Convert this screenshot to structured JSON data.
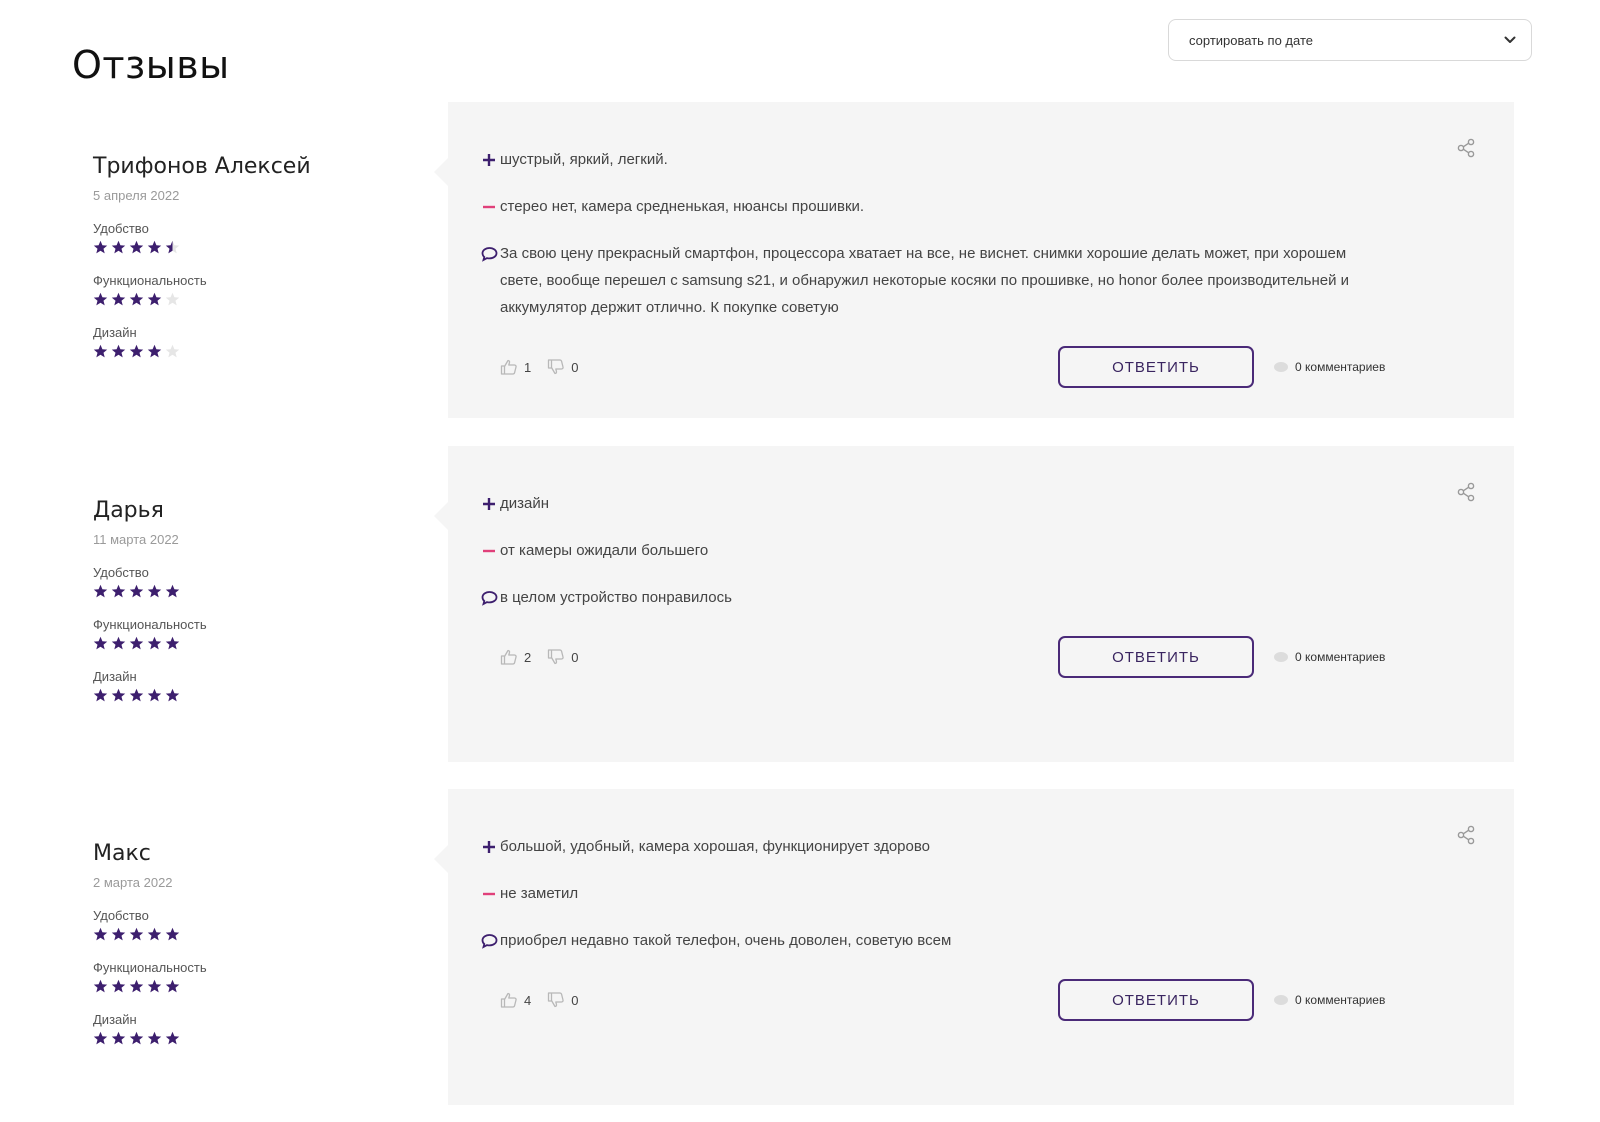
{
  "header": {
    "title": "Отзывы",
    "sort_label": "сортировать по дате"
  },
  "colors": {
    "accent": "#3d1f6e",
    "minus": "#e0407a",
    "card_bg": "#f5f5f5"
  },
  "actions": {
    "reply_label": "ОТВЕТИТЬ"
  },
  "reviews": [
    {
      "author": "Трифонов Алексей",
      "date": "5 апреля 2022",
      "ratings": [
        {
          "label": "Удобство",
          "value": 4.5
        },
        {
          "label": "Функциональность",
          "value": 4
        },
        {
          "label": "Дизайн",
          "value": 4
        }
      ],
      "pros": "шустрый, яркий, легкий.",
      "cons": "стерео нет, камера средненькая, нюансы прошивки.",
      "comment": "За свою цену прекрасный смартфон, процессора хватает на все, не виснет. снимки хорошие делать может, при хорошем свете, вообще перешел с samsung s21, и обнаружил некоторые косяки по прошивке, но honor более производительней и аккумулятор держит отлично. К покупке советую",
      "likes": "1",
      "dislikes": "0",
      "comments_count": "0 комментариев"
    },
    {
      "author": "Дарья",
      "date": "11 марта 2022",
      "ratings": [
        {
          "label": "Удобство",
          "value": 5
        },
        {
          "label": "Функциональность",
          "value": 5
        },
        {
          "label": "Дизайн",
          "value": 5
        }
      ],
      "pros": "дизайн",
      "cons": "от камеры ожидали большего",
      "comment": "в целом устройство понравилось",
      "likes": "2",
      "dislikes": "0",
      "comments_count": "0 комментариев"
    },
    {
      "author": "Макс",
      "date": "2 марта 2022",
      "ratings": [
        {
          "label": "Удобство",
          "value": 5
        },
        {
          "label": "Функциональность",
          "value": 5
        },
        {
          "label": "Дизайн",
          "value": 5
        }
      ],
      "pros": "большой, удобный, камера хорошая, функционирует здорово",
      "cons": "не заметил",
      "comment": "приобрел недавно такой телефон, очень доволен, советую всем",
      "likes": "4",
      "dislikes": "0",
      "comments_count": "0 комментариев"
    }
  ]
}
